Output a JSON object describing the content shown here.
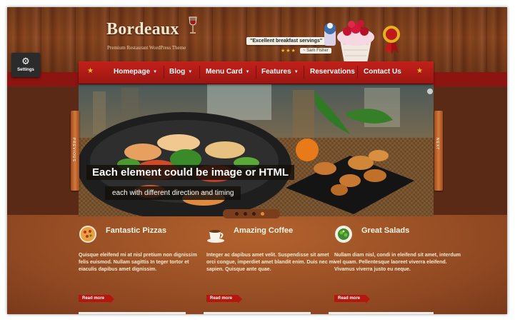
{
  "brand": {
    "name": "Bordeaux",
    "tagline": "Premium Restaurant WordPress Theme"
  },
  "testimonial": {
    "quote": "\"Excellent breakfast servings\"",
    "rating": "★★★",
    "author": "~ Sam Fisher"
  },
  "settings": {
    "label": "Settings"
  },
  "nav": {
    "items": [
      {
        "label": "Homepage",
        "dropdown": true
      },
      {
        "label": "Blog",
        "dropdown": true
      },
      {
        "label": "Menu Card",
        "dropdown": true
      },
      {
        "label": "Features",
        "dropdown": true
      },
      {
        "label": "Reservations",
        "dropdown": false
      },
      {
        "label": "Contact Us",
        "dropdown": false
      }
    ]
  },
  "slider": {
    "caption_main": "Each element could be image or HTML",
    "caption_sub": "each with different direction and timing",
    "prev_label": "PREVIOUS",
    "next_label": "NEXT",
    "slide_count": 4,
    "active_slide": 3
  },
  "features": [
    {
      "title": "Fantastic Pizzas",
      "icon": "pizza-icon",
      "text": "Quisque eleifend mi at nisl pretium non dignissim felis euismod. Nullam sagittis In teger tortor et eiaculis dapibus amet dignissim.",
      "more": "Read more"
    },
    {
      "title": "Amazing Coffee",
      "icon": "coffee-icon",
      "text": "Integer ac dapibus amet velit. Suspendisse sit amet orci congue, imperdiet amet blandit enim. Duis nec mi sapien. Quisque ante quae.",
      "more": "Read more"
    },
    {
      "title": "Great Salads",
      "icon": "salad-icon",
      "text": "Nullam diam nisl, condi in eleifend sit amet, interdum vel quam. Pellentesque laoreet viverra eleifend. Vivamus viverra justo eu neque.",
      "more": "Read more"
    }
  ],
  "colors": {
    "nav_red": "#c4201a",
    "wood": "#7a3d1c",
    "content_brown": "#a65a28"
  }
}
